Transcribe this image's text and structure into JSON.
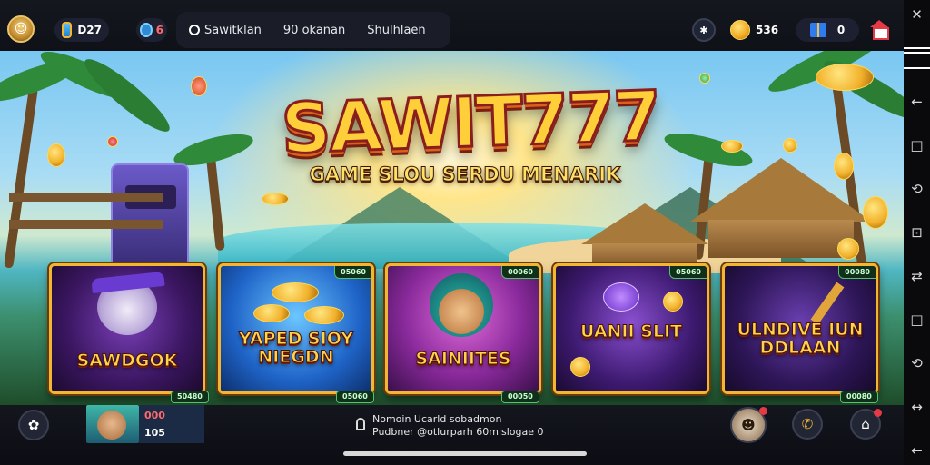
{
  "topbar": {
    "balance": "D27",
    "notifications": "6",
    "tabs": [
      {
        "label": "Sawitklan"
      },
      {
        "label": "90 okanan"
      },
      {
        "label": "Shulhlaen"
      }
    ],
    "coins": "536",
    "gifts": "0"
  },
  "hero": {
    "logo": "SAWIT777",
    "tagline": "GAME SLOU SERDU MENARIK"
  },
  "games": [
    {
      "name": "SAWDGOK",
      "badge": "",
      "foot": "50480"
    },
    {
      "name": "YAPED SIOY NIEGDN",
      "badge": "05060",
      "foot": "05060"
    },
    {
      "name": "SAINIITES",
      "badge": "00060",
      "foot": "00050"
    },
    {
      "name": "UANII SLIT",
      "badge": "05060",
      "foot": ""
    },
    {
      "name": "ULNDIVE IUN DDLAAN",
      "badge": "00080",
      "foot": "00080"
    }
  ],
  "bottombar": {
    "player_stat1": "000",
    "player_stat2": "105",
    "notice_line1": "Nomoin Ucarld sobadmon",
    "notice_line2": "Pudbner @otlurparh 60mlslogae 0"
  },
  "sidenav": [
    "✕",
    "←",
    "□",
    "⟲",
    "⊡",
    "⇄",
    "□",
    "⟲",
    "↔",
    "←"
  ],
  "colors": {
    "gold": "#f2b632",
    "panel": "#1a1c27",
    "accent_red": "#e63946"
  }
}
